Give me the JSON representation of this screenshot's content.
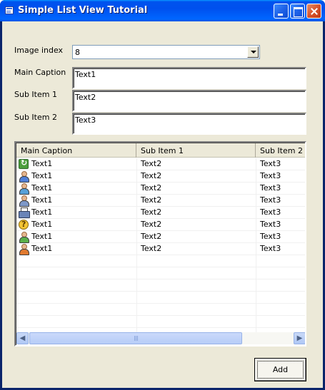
{
  "window": {
    "title": "Simple List View Tutorial"
  },
  "form": {
    "image_index_label": "Image index",
    "image_index_value": "8",
    "main_caption_label": "Main Caption",
    "main_caption_value": "Text1",
    "sub_item1_label": "Sub Item 1",
    "sub_item1_value": "Text2",
    "sub_item2_label": "Sub Item 2",
    "sub_item2_value": "Text3"
  },
  "listview": {
    "columns": [
      "Main Caption",
      "Sub Item 1",
      "Sub Item 2"
    ],
    "rows": [
      {
        "icon": "refresh-icon",
        "main": "Text1",
        "sub1": "Text2",
        "sub2": "Text3"
      },
      {
        "icon": "user-blue-icon",
        "main": "Text1",
        "sub1": "Text2",
        "sub2": "Text3"
      },
      {
        "icon": "user-edit-icon",
        "main": "Text1",
        "sub1": "Text2",
        "sub2": "Text3"
      },
      {
        "icon": "user-delete-icon",
        "main": "Text1",
        "sub1": "Text2",
        "sub2": "Text3"
      },
      {
        "icon": "printer-icon",
        "main": "Text1",
        "sub1": "Text2",
        "sub2": "Text3"
      },
      {
        "icon": "help-icon",
        "main": "Text1",
        "sub1": "Text2",
        "sub2": "Text3"
      },
      {
        "icon": "user-green-icon",
        "main": "Text1",
        "sub1": "Text2",
        "sub2": "Text3"
      },
      {
        "icon": "user-orange-icon",
        "main": "Text1",
        "sub1": "Text2",
        "sub2": "Text3"
      }
    ]
  },
  "buttons": {
    "add_label": "Add"
  },
  "colors": {
    "titlebar": "#0055e5",
    "client": "#ece9d8"
  }
}
